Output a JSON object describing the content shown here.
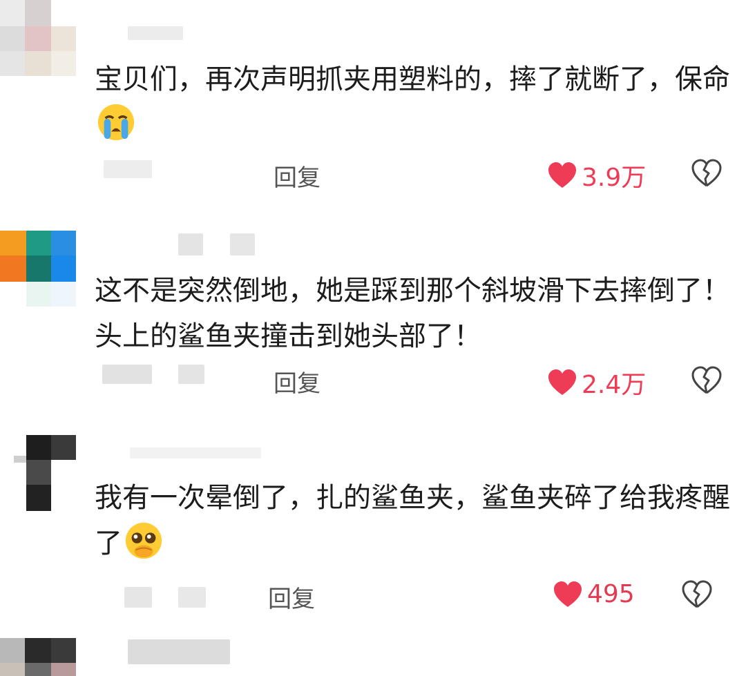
{
  "comments": [
    {
      "text": "宝贝们，再次声明抓夹用塑料的，摔了就断了，保命",
      "emoji": "loudly-crying-face",
      "reply_label": "回复",
      "likes": "3.9万"
    },
    {
      "text": "这不是突然倒地，她是踩到那个斜坡滑下去摔倒了！头上的鲨鱼夹撞击到她头部了！",
      "emoji": "",
      "reply_label": "回复",
      "likes": "2.4万"
    },
    {
      "text": "我有一次晕倒了，扎的鲨鱼夹，鲨鱼夹碎了给我疼醒了",
      "emoji": "pleading-face-hands-over-mouth",
      "reply_label": "回复",
      "likes": "495"
    }
  ],
  "colors": {
    "like_red": "#ee3b56",
    "reply_gray": "#555555",
    "text": "#1c1c1c"
  },
  "icons": [
    "heart-icon",
    "broken-heart-icon"
  ]
}
